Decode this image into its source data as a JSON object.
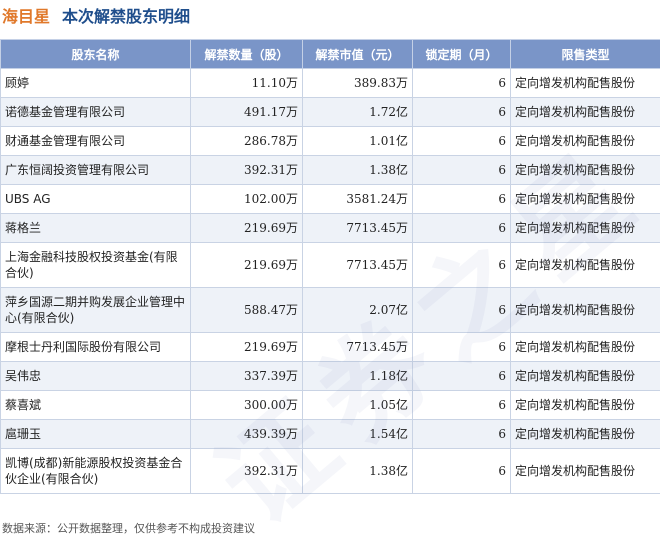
{
  "header": {
    "stock_name": "海目星",
    "subtitle": "本次解禁股东明细"
  },
  "table": {
    "columns": [
      "股东名称",
      "解禁数量（股）",
      "解禁市值（元）",
      "锁定期（月）",
      "限售类型"
    ],
    "rows": [
      {
        "name": "顾婷",
        "qty": "11.10万",
        "value": "389.83万",
        "lock": "6",
        "type": "定向增发机构配售股份"
      },
      {
        "name": "诺德基金管理有限公司",
        "qty": "491.17万",
        "value": "1.72亿",
        "lock": "6",
        "type": "定向增发机构配售股份"
      },
      {
        "name": "财通基金管理有限公司",
        "qty": "286.78万",
        "value": "1.01亿",
        "lock": "6",
        "type": "定向增发机构配售股份"
      },
      {
        "name": "广东恒阔投资管理有限公司",
        "qty": "392.31万",
        "value": "1.38亿",
        "lock": "6",
        "type": "定向增发机构配售股份"
      },
      {
        "name": "UBS AG",
        "qty": "102.00万",
        "value": "3581.24万",
        "lock": "6",
        "type": "定向增发机构配售股份"
      },
      {
        "name": "蒋格兰",
        "qty": "219.69万",
        "value": "7713.45万",
        "lock": "6",
        "type": "定向增发机构配售股份"
      },
      {
        "name": "上海金融科技股权投资基金(有限合伙)",
        "qty": "219.69万",
        "value": "7713.45万",
        "lock": "6",
        "type": "定向增发机构配售股份"
      },
      {
        "name": "萍乡国源二期并购发展企业管理中心(有限合伙)",
        "qty": "588.47万",
        "value": "2.07亿",
        "lock": "6",
        "type": "定向增发机构配售股份"
      },
      {
        "name": "摩根士丹利国际股份有限公司",
        "qty": "219.69万",
        "value": "7713.45万",
        "lock": "6",
        "type": "定向增发机构配售股份"
      },
      {
        "name": "吴伟忠",
        "qty": "337.39万",
        "value": "1.18亿",
        "lock": "6",
        "type": "定向增发机构配售股份"
      },
      {
        "name": "蔡喜斌",
        "qty": "300.00万",
        "value": "1.05亿",
        "lock": "6",
        "type": "定向增发机构配售股份"
      },
      {
        "name": "扈珊玉",
        "qty": "439.39万",
        "value": "1.54亿",
        "lock": "6",
        "type": "定向增发机构配售股份"
      },
      {
        "name": "凯博(成都)新能源股权投资基金合伙企业(有限合伙)",
        "qty": "392.31万",
        "value": "1.38亿",
        "lock": "6",
        "type": "定向增发机构配售股份"
      }
    ]
  },
  "footer": {
    "source_note": "数据来源：公开数据整理，仅供参考不构成投资建议"
  },
  "watermark": {
    "text": "证券之星"
  },
  "colors": {
    "header_bg": "#7a95c8",
    "stripe_bg": "#eef2f8",
    "stock_name": "#e0782a",
    "subtitle": "#1f4e8c"
  }
}
